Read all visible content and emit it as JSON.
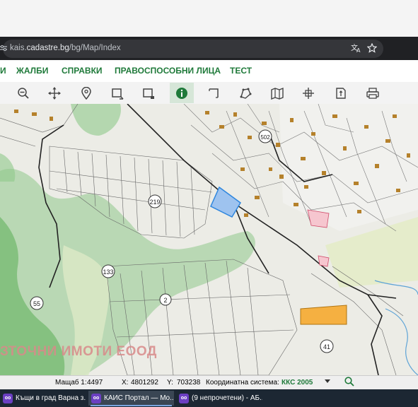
{
  "browser": {
    "url_prefix": "kais.",
    "url_domain": "cadastre.bg",
    "url_path": "/bg/Map/Index"
  },
  "nav": {
    "items": [
      {
        "label": "И"
      },
      {
        "label": "ЖАЛБИ"
      },
      {
        "label": "СПРАВКИ"
      },
      {
        "label": "ПРАВОСПОСОБНИ ЛИЦА"
      },
      {
        "label": "ТЕСТ"
      }
    ],
    "color": "#1f7a3a"
  },
  "toolbar": {
    "tools": [
      "zoom-out-icon",
      "pan-icon",
      "location-pin-icon",
      "select-rectangle-icon",
      "select-rectangle-dashed-icon",
      "info-icon",
      "measure-icon",
      "draw-polygon-icon",
      "map-layers-icon",
      "coordinates-icon",
      "export-icon",
      "print-icon"
    ],
    "active_tool": "info-icon"
  },
  "map": {
    "labels": {
      "parcel_219": "219",
      "parcel_133": "133",
      "parcel_55": "55",
      "parcel_2": "2",
      "parcel_41": "41",
      "parcel_502": "502"
    },
    "company_overlay": "ЗТОЧНИ ИМОТИ ЕООД",
    "colors": {
      "forest": "#8fc98a",
      "selected_parcel": "#9ec3ef",
      "highlight_parcel": "#f5b041",
      "building": "#b5812b"
    }
  },
  "status": {
    "scale_label": "Мащаб 1:",
    "scale_value": "4497",
    "x_label": "X:",
    "x_value": "4801292",
    "y_label": "Y:",
    "y_value": "703238",
    "coord_system_label": "Координатна система:",
    "coord_system_value": "ККС 2005"
  },
  "taskbar": {
    "tasks": [
      {
        "label": "Къщи в град Варна з..."
      },
      {
        "label": "КАИС Портал — Mo..."
      },
      {
        "label": "(9 непрочетени) - АБ..."
      }
    ]
  }
}
